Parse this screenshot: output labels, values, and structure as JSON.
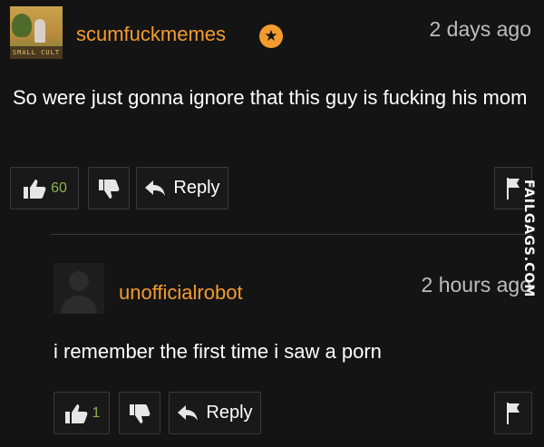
{
  "comment1": {
    "avatar_text": "SMALL CULT",
    "username": "scumfuckmemes",
    "badge": "★",
    "timestamp": "2 days ago",
    "text": "So were just gonna ignore that this guy is fucking his mom",
    "likes": "60",
    "reply_label": "Reply"
  },
  "comment2": {
    "username": "unofficialrobot",
    "timestamp": "2 hours ago",
    "text": "i remember the first time i saw a porn",
    "likes": "1",
    "reply_label": "Reply"
  },
  "watermark": "FAILGAGS.COM",
  "colors": {
    "background": "#141414",
    "username": "#f39b2e",
    "like_count": "#8fb24e",
    "button_border": "#3a3a3a"
  },
  "icons": [
    "thumbs-up-icon",
    "thumbs-down-icon",
    "reply-arrow-icon",
    "flag-icon",
    "star-icon"
  ]
}
